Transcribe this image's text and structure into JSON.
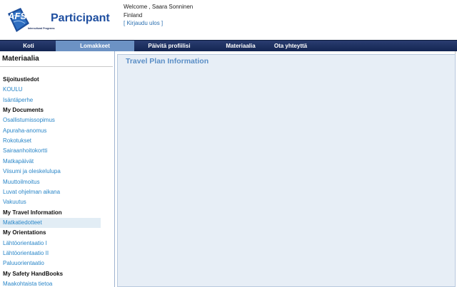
{
  "header": {
    "logo_text": "Participant",
    "logo_badge": "AFS",
    "logo_sub": "Intercultural Programs",
    "welcome_text": "Welcome , Saara Sonninen",
    "country": "Finland",
    "logout_label": "[ Kirjaudu ulos ]"
  },
  "nav": {
    "items": [
      {
        "label": "Koti"
      },
      {
        "label": "Lomakkeet"
      },
      {
        "label": "Päivitä profiilisi"
      },
      {
        "label": "Materiaalia"
      },
      {
        "label": "Ota yhteyttä"
      }
    ],
    "active_index": 1
  },
  "sidebar": {
    "title": "Materiaalia",
    "items": [
      {
        "label": "Sijoitustiedot",
        "kind": "heading"
      },
      {
        "label": "KOULU",
        "kind": "link"
      },
      {
        "label": "Isäntäperhe",
        "kind": "link"
      },
      {
        "label": "My Documents",
        "kind": "heading"
      },
      {
        "label": "Osallistumissopimus",
        "kind": "link"
      },
      {
        "label": "Apuraha-anomus",
        "kind": "link"
      },
      {
        "label": "Rokotukset",
        "kind": "link"
      },
      {
        "label": "Sairaanhoitokortti",
        "kind": "link"
      },
      {
        "label": "Matkapäivät",
        "kind": "link"
      },
      {
        "label": "Viisumi ja oleskelulupa",
        "kind": "link"
      },
      {
        "label": "Muuttoilmoitus",
        "kind": "link"
      },
      {
        "label": "Luvat ohjelman aikana",
        "kind": "link"
      },
      {
        "label": "Vakuutus",
        "kind": "link"
      },
      {
        "label": "My Travel Information",
        "kind": "heading"
      },
      {
        "label": "Matkatiedotteet",
        "kind": "link",
        "selected": true
      },
      {
        "label": "My Orientations",
        "kind": "heading"
      },
      {
        "label": "Lähtöorientaatio I",
        "kind": "link"
      },
      {
        "label": "Lähtöorientaatio II",
        "kind": "link"
      },
      {
        "label": "Paluuorientaatio",
        "kind": "link"
      },
      {
        "label": "My Safety HandBooks",
        "kind": "heading"
      },
      {
        "label": "Maakohtaista tietoa",
        "kind": "link"
      }
    ]
  },
  "main": {
    "title": "Travel Plan Information"
  },
  "colors": {
    "nav_bg": "#1b2c5c",
    "nav_active": "#6c92c4",
    "link": "#2a86c8",
    "panel_bg": "#e7eef6",
    "title_blue": "#5a8ec6"
  }
}
